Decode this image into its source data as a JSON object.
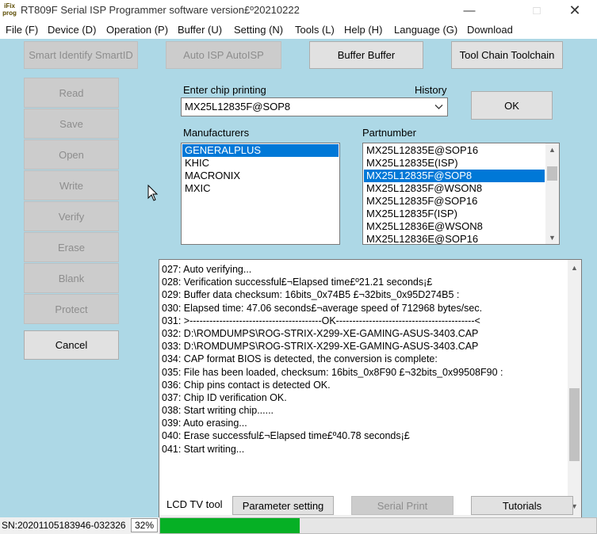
{
  "window": {
    "title": "RT809F Serial ISP Programmer software version£º20210222",
    "logo": "iFix prog"
  },
  "menu": [
    "File (F)",
    "Device (D)",
    "Operation (P)",
    "Buffer (U)",
    "Setting (N)",
    "Tools (L)",
    "Help (H)",
    "Language (G)",
    "Download"
  ],
  "toolbar": {
    "smart_identify": "Smart Identify SmartID",
    "auto_isp": "Auto ISP AutoISP",
    "buffer": "Buffer Buffer",
    "tool_chain": "Tool Chain Toolchain"
  },
  "side_buttons": [
    "Read",
    "Save",
    "Open",
    "Write",
    "Verify",
    "Erase",
    "Blank",
    "Protect"
  ],
  "cancel_label": "Cancel",
  "chip": {
    "label": "Enter chip printing",
    "history_label": "History",
    "value": "MX25L12835F@SOP8",
    "ok_label": "OK"
  },
  "manufacturers": {
    "label": "Manufacturers",
    "items": [
      "GENERALPLUS",
      "KHIC",
      "MACRONIX",
      "MXIC"
    ],
    "selected": "GENERALPLUS"
  },
  "partnumber": {
    "label": "Partnumber",
    "items": [
      "MX25L12835E@SOP16",
      "MX25L12835E(ISP)",
      "MX25L12835F@SOP8",
      "MX25L12835F@WSON8",
      "MX25L12835F@SOP16",
      "MX25L12835F(ISP)",
      "MX25L12836E@WSON8",
      "MX25L12836E@SOP16"
    ],
    "selected": "MX25L12835F@SOP8"
  },
  "log": [
    "027:  Auto verifying...",
    "028:  Verification successful£¬Elapsed time£º21.21 seconds¡£",
    "029:  Buffer data checksum: 16bits_0x74B5 £¬32bits_0x95D274B5 :",
    "030:  Elapsed time: 47.06 seconds£¬average speed of 712968 bytes/sec.",
    "031:  >----------------------------------------OK------------------------------------------<",
    "032:  D:\\ROMDUMPS\\ROG-STRIX-X299-XE-GAMING-ASUS-3403.CAP",
    "033:  D:\\ROMDUMPS\\ROG-STRIX-X299-XE-GAMING-ASUS-3403.CAP",
    "034:  CAP format BIOS is detected, the conversion is complete:",
    "035:  File has been loaded, checksum: 16bits_0x8F90 £¬32bits_0x99508F90 :",
    "036:  Chip pins contact is detected OK.",
    "037:  Chip ID verification OK.",
    "038:  Start writing chip......",
    "039:  Auto erasing...",
    "040:  Erase successful£¬Elapsed time£º40.78 seconds¡£",
    "041:  Start writing..."
  ],
  "bottom": {
    "lcd_label": "LCD TV tool",
    "parameter": "Parameter setting",
    "serial_print": "Serial Print",
    "tutorials": "Tutorials"
  },
  "status": {
    "sn": "SN:20201105183946-032326",
    "percent_text": "32%",
    "progress": 0.32
  },
  "colors": {
    "client_bg": "#add8e6",
    "selection": "#0078d7",
    "progress": "#06b025"
  }
}
